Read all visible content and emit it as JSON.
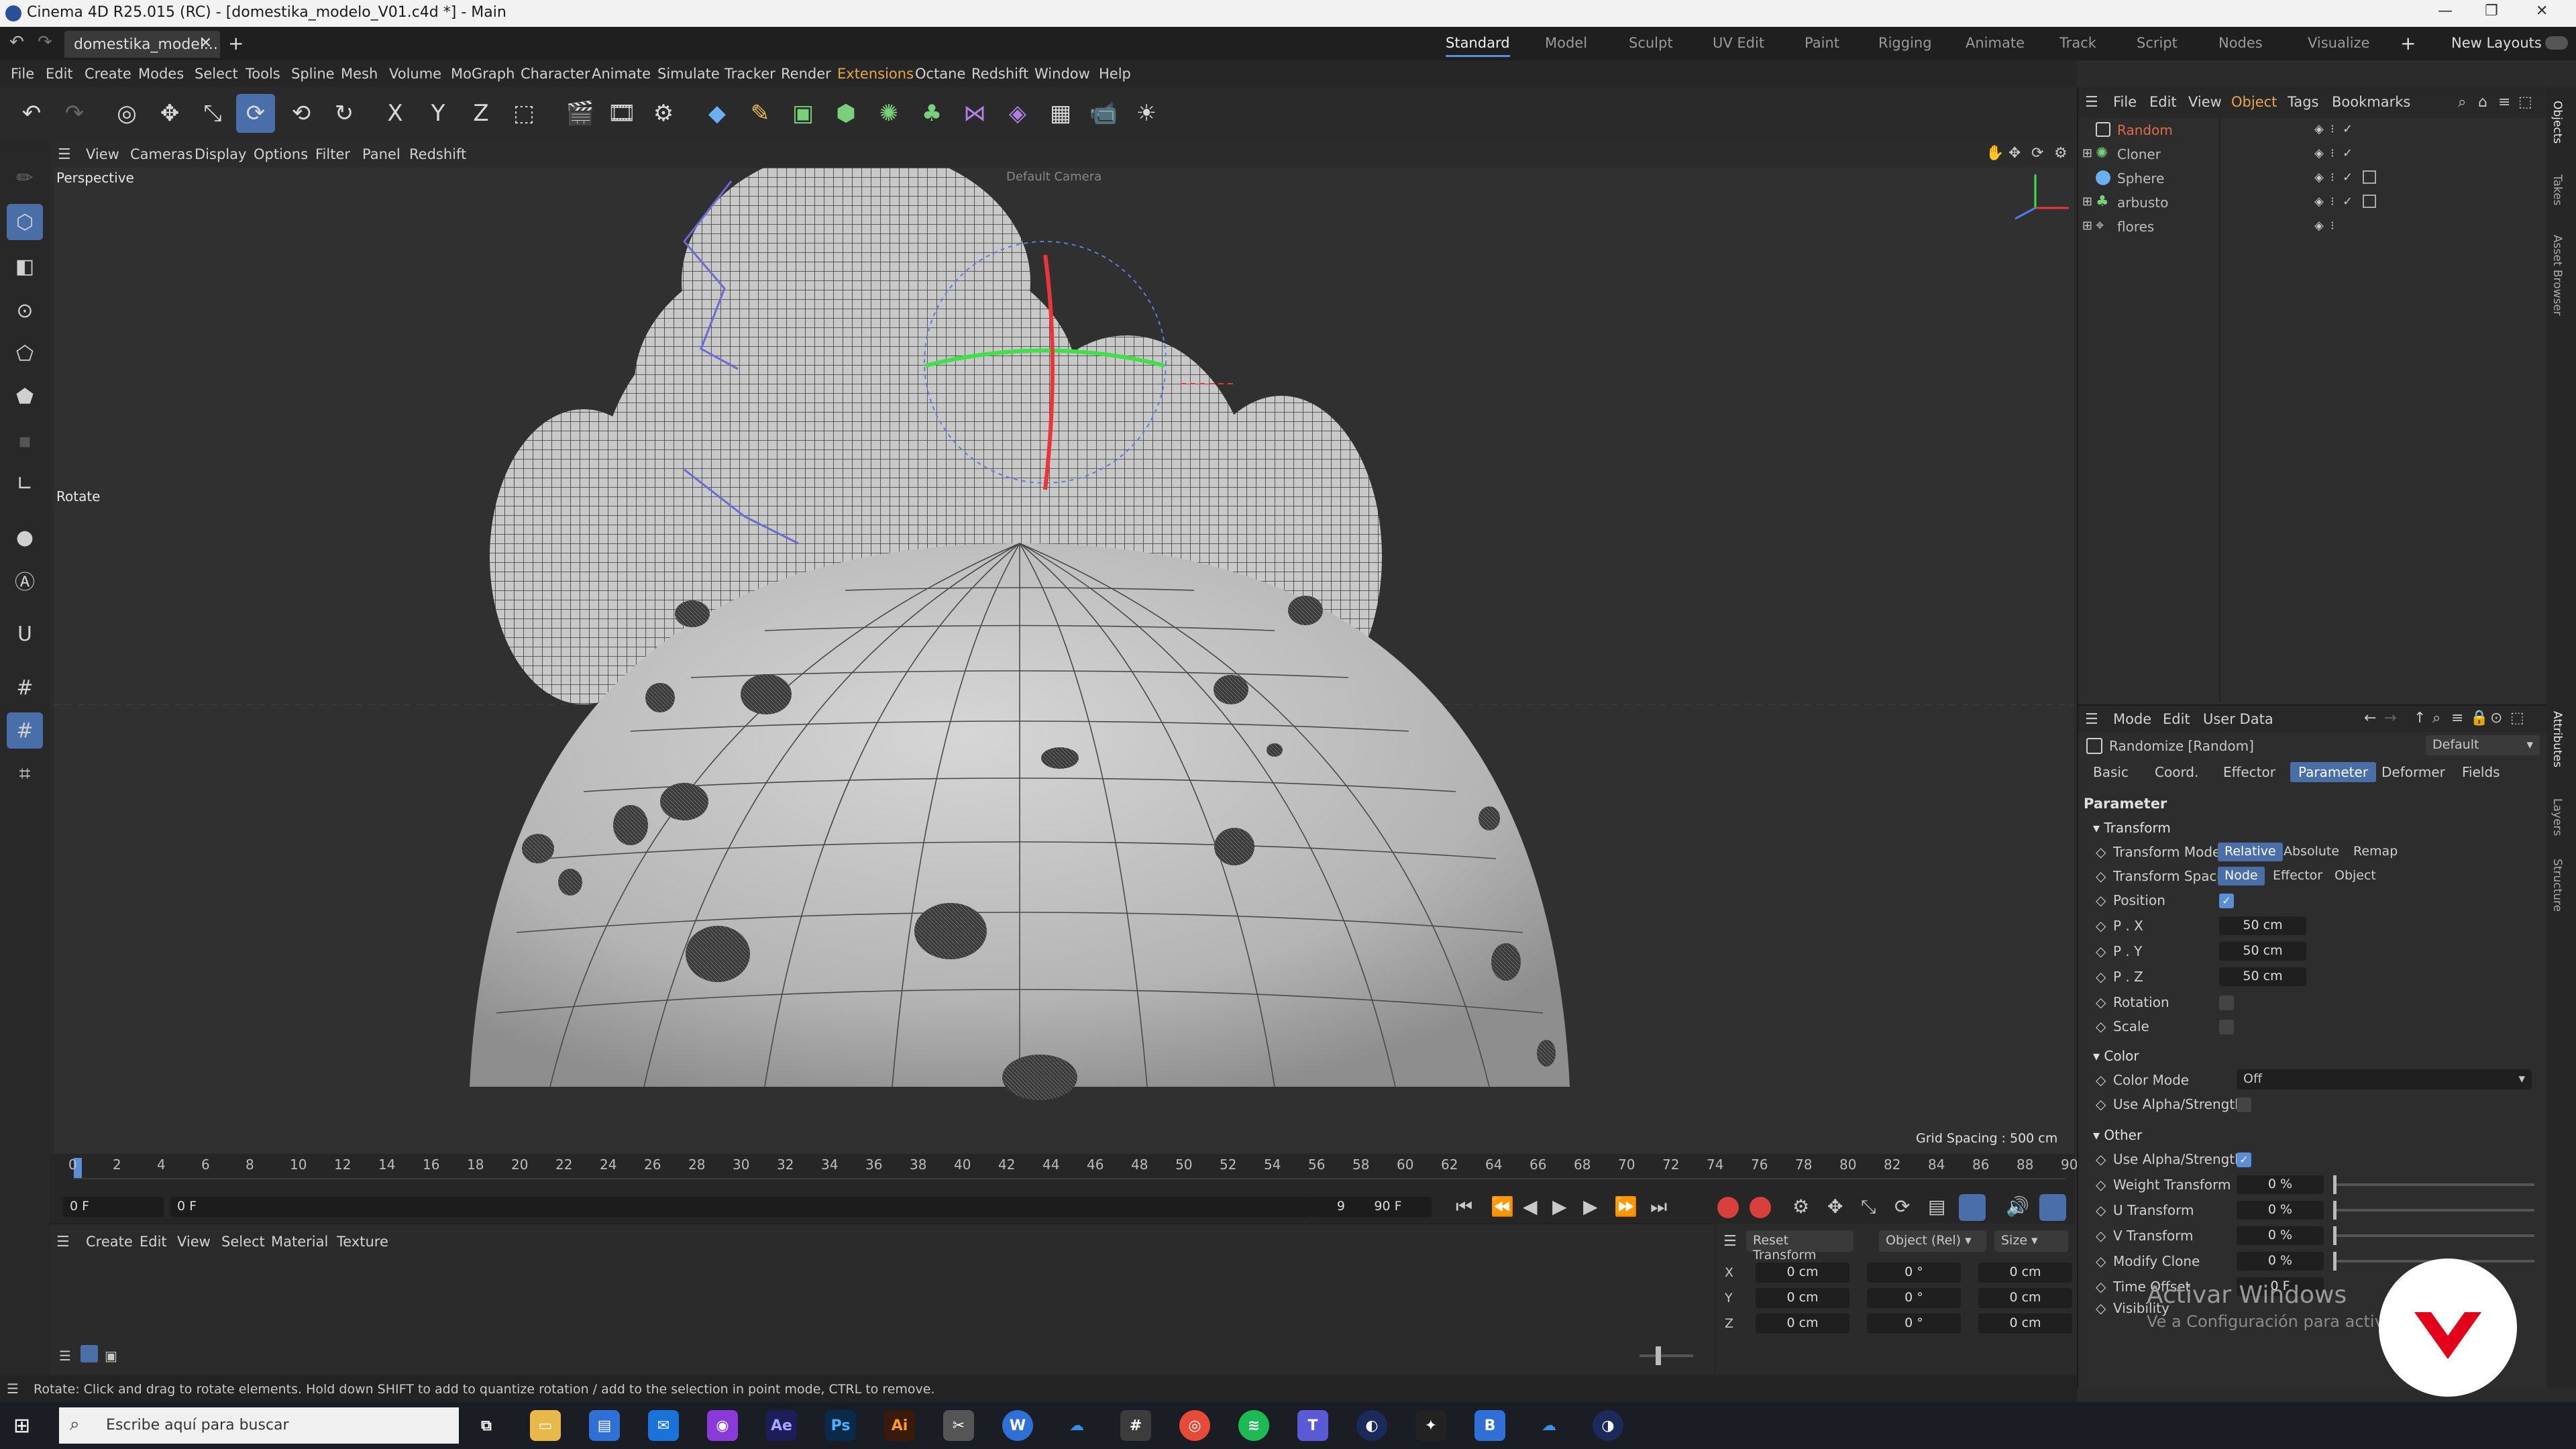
{
  "window": {
    "title": "Cinema 4D R25.015 (RC) - [domestika_modelo_V01.c4d *] - Main"
  },
  "tabs": {
    "doc_tab": "domestika_model...",
    "new_tab": "+"
  },
  "layouts": {
    "items": [
      "Standard",
      "Model",
      "Sculpt",
      "UV Edit",
      "Paint",
      "Rigging",
      "Animate",
      "Track",
      "Script",
      "Nodes",
      "Visualize"
    ],
    "active": "Standard",
    "new_layouts": "New Layouts"
  },
  "menu": {
    "items": [
      "File",
      "Edit",
      "Create",
      "Modes",
      "Select",
      "Tools",
      "Spline",
      "Mesh",
      "Volume",
      "MoGraph",
      "Character",
      "Animate",
      "Simulate",
      "Tracker",
      "Render",
      "Extensions",
      "Octane",
      "Redshift",
      "Window",
      "Help"
    ]
  },
  "viewport_menu": {
    "items": [
      "View",
      "Cameras",
      "Display",
      "Options",
      "Filter",
      "Panel",
      "Redshift"
    ]
  },
  "viewport": {
    "label": "Perspective",
    "camera_label": "Default Camera",
    "tool_label": "Rotate",
    "grid_spacing": "Grid Spacing : 500 cm"
  },
  "timeline": {
    "ticks": [
      "0",
      "2",
      "4",
      "6",
      "8",
      "10",
      "12",
      "14",
      "16",
      "18",
      "20",
      "22",
      "24",
      "26",
      "28",
      "30",
      "32",
      "34",
      "36",
      "38",
      "40",
      "42",
      "44",
      "46",
      "48",
      "50",
      "52",
      "54",
      "56",
      "58",
      "60",
      "62",
      "64",
      "66",
      "68",
      "70",
      "72",
      "74",
      "76",
      "78",
      "80",
      "82",
      "84",
      "86",
      "88",
      "90"
    ],
    "current_frame": "0 F",
    "start_frame": "0 F",
    "end_frame_a": "90 F",
    "end_frame_b": "90 F"
  },
  "material_manager": {
    "menu": [
      "Create",
      "Edit",
      "View",
      "Select",
      "Material",
      "Texture"
    ]
  },
  "coordinates": {
    "reset": "Reset Transform",
    "mode": "Object (Rel)",
    "size_mode": "Size",
    "axes": [
      "X",
      "Y",
      "Z"
    ],
    "pos": [
      "0 cm",
      "0 cm",
      "0 cm"
    ],
    "rot": [
      "0 °",
      "0 °",
      "0 °"
    ],
    "size": [
      "0 cm",
      "0 cm",
      "0 cm"
    ]
  },
  "object_manager": {
    "menu": [
      "File",
      "Edit",
      "View",
      "Object",
      "Tags",
      "Bookmarks"
    ],
    "objects": [
      {
        "name": "Random",
        "color": "#e06a4a"
      },
      {
        "name": "Cloner",
        "color": "#bdbdbd"
      },
      {
        "name": "Sphere",
        "color": "#bdbdbd"
      },
      {
        "name": "arbusto",
        "color": "#bdbdbd"
      },
      {
        "name": "flores",
        "color": "#bdbdbd"
      }
    ]
  },
  "attributes": {
    "menu": [
      "Mode",
      "Edit",
      "User Data"
    ],
    "object_title": "Randomize [Random]",
    "preset": "Default",
    "tabs": [
      "Basic",
      "Coord.",
      "Effector",
      "Parameter",
      "Deformer",
      "Fields"
    ],
    "active_tab": "Parameter",
    "section": "Parameter",
    "transform": {
      "group": "Transform",
      "mode_label": "Transform Mode",
      "modes": [
        "Relative",
        "Absolute",
        "Remap"
      ],
      "space_label": "Transform Space",
      "spaces": [
        "Node",
        "Effector",
        "Object"
      ],
      "position": "Position",
      "px_label": "P . X",
      "px": "50 cm",
      "py_label": "P . Y",
      "py": "50 cm",
      "pz_label": "P . Z",
      "pz": "50 cm",
      "rotation": "Rotation",
      "scale": "Scale"
    },
    "color": {
      "group": "Color",
      "mode_label": "Color Mode",
      "mode_value": "Off",
      "alpha_label": "Use Alpha/Strength"
    },
    "other": {
      "group": "Other",
      "alpha_label": "Use Alpha/Strength",
      "weight_label": "Weight Transform",
      "weight": "0 %",
      "u_label": "U Transform",
      "u": "0 %",
      "v_label": "V Transform",
      "v": "0 %",
      "clone_label": "Modify Clone",
      "clone": "0 %",
      "time_label": "Time Offset",
      "time": "0 F",
      "vis_label": "Visibility"
    }
  },
  "right_strip": {
    "tabs": [
      "Objects",
      "Takes",
      "Asset Browser",
      "Attributes",
      "Layers",
      "Structure"
    ]
  },
  "status": {
    "text": "Rotate: Click and drag to rotate elements. Hold down SHIFT to add to quantize rotation / add to the selection in point mode, CTRL to remove."
  },
  "taskbar": {
    "search_placeholder": "Escribe aquí para buscar"
  },
  "watermark": {
    "line1": "Activar Windows",
    "line2": "Ve a Configuración para activar"
  }
}
